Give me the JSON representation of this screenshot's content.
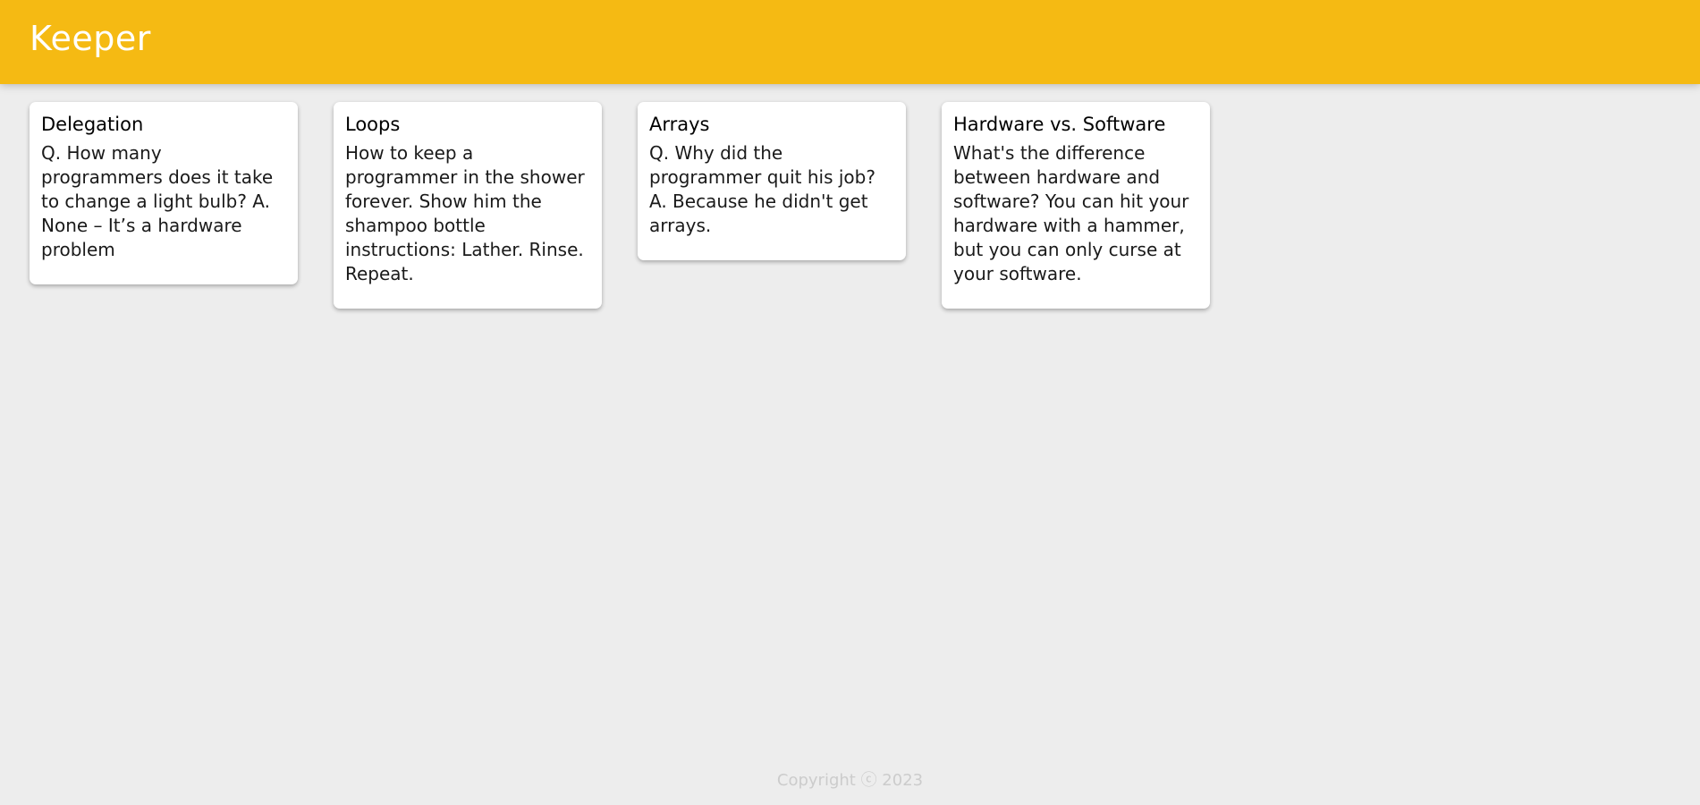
{
  "header": {
    "title": "Keeper"
  },
  "colors": {
    "accent": "#f5ba13",
    "background": "#ededed",
    "card": "#ffffff",
    "footer_text": "#cccccc"
  },
  "notes": [
    {
      "title": "Delegation",
      "content": "Q. How many programmers does it take to change a light bulb? A. None – It’s a hardware problem"
    },
    {
      "title": "Loops",
      "content": "How to keep a programmer in the shower forever. Show him the shampoo bottle instructions: Lather. Rinse. Repeat."
    },
    {
      "title": "Arrays",
      "content": "Q. Why did the programmer quit his job? A. Because he didn't get arrays."
    },
    {
      "title": "Hardware vs. Software",
      "content": "What's the difference between hardware and software? You can hit your hardware with a hammer, but you can only curse at your software."
    }
  ],
  "footer": {
    "copyright": "Copyright ⓒ 2023"
  }
}
